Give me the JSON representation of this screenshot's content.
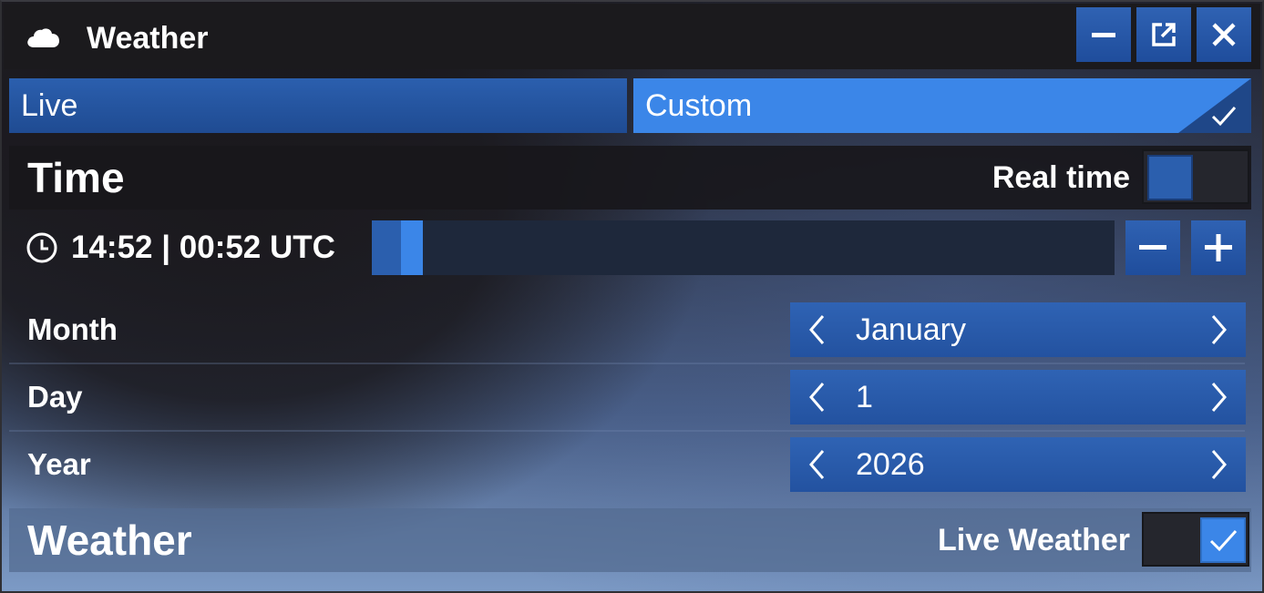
{
  "window": {
    "title": "Weather",
    "icons": [
      "cloud-icon",
      "minimize-icon",
      "popout-icon",
      "close-icon"
    ]
  },
  "tabs": [
    {
      "label": "Live",
      "selected": false
    },
    {
      "label": "Custom",
      "selected": true
    }
  ],
  "time_section": {
    "title": "Time",
    "real_time_label": "Real time",
    "real_time_on": false,
    "time_text": "14:52 | 00:52 UTC",
    "time_slider_fraction": 0.04,
    "rows": [
      {
        "label": "Month",
        "value": "January"
      },
      {
        "label": "Day",
        "value": "1"
      },
      {
        "label": "Year",
        "value": "2026"
      }
    ]
  },
  "weather_section": {
    "title": "Weather",
    "live_weather_label": "Live Weather",
    "live_weather_on": true
  },
  "colors": {
    "accent": "#3b86e8",
    "button": "#2a5caf",
    "titlebar": "#1b1a1d"
  }
}
